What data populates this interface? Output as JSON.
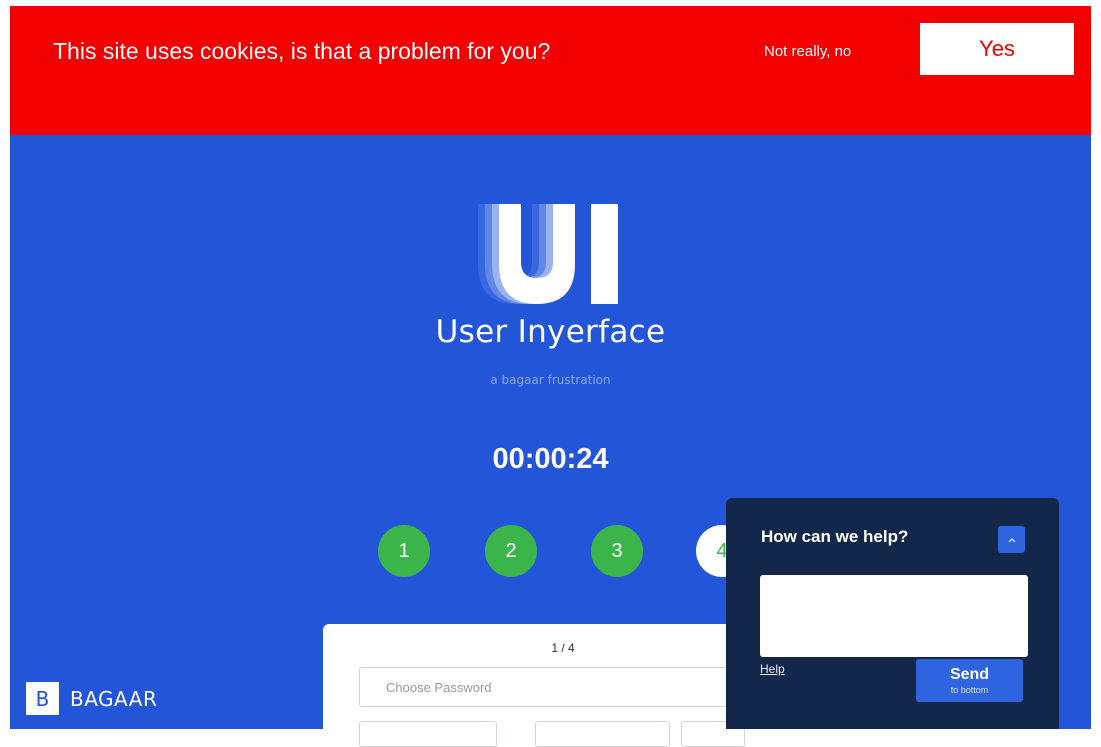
{
  "cookie": {
    "message": "This site uses cookies, is that a problem for you?",
    "decline_label": "Not really, no",
    "accept_label": "Yes"
  },
  "app": {
    "title": "User Inyerface",
    "subtitle": "a bagaar frustration",
    "logo_letters": "UI"
  },
  "timer": "00:00:24",
  "steps": [
    {
      "label": "1",
      "state": "done"
    },
    {
      "label": "2",
      "state": "done"
    },
    {
      "label": "3",
      "state": "done"
    },
    {
      "label": "4",
      "state": "current"
    }
  ],
  "form": {
    "page_indicator": "1 / 4",
    "password_placeholder": "Choose Password"
  },
  "brand": {
    "mark": "B",
    "name": "BAGAAR"
  },
  "help": {
    "title": "How can we help?",
    "toggle_icon": "chevron-up-icon",
    "link_label": "Help",
    "send_label": "Send",
    "send_sub": "to bottom"
  },
  "colors": {
    "background": "#2355d9",
    "cookie_bar": "#f20000",
    "step_done": "#3bb54a",
    "help_panel": "#13274a",
    "accent_button": "#2f64e0"
  }
}
